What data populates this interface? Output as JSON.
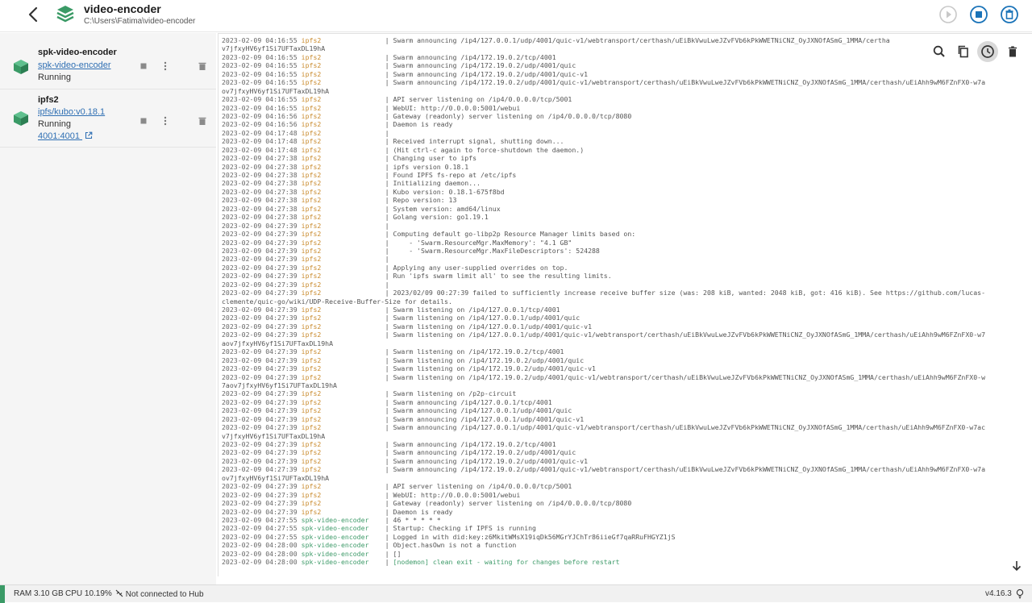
{
  "header": {
    "title": "video-encoder",
    "path": "C:\\Users\\Fatima\\video-encoder"
  },
  "containers": [
    {
      "name": "spk-video-encoder",
      "image": "spk-video-encoder",
      "status": "Running",
      "port": ""
    },
    {
      "name": "ipfs2",
      "image": "ipfs/kubo:v0.18.1",
      "status": "Running",
      "port": "4001:4001"
    }
  ],
  "logs": [
    {
      "ts": "2023-02-09 04:16:55",
      "svc": "ipfs2",
      "msg": "Swarm announcing /ip4/127.0.0.1/udp/4001/quic-v1/webtransport/certhash/uEiBkVwuLweJZvFVb6kPkWWETNiCNZ_OyJXNOfASmG_1MMA/certha"
    },
    {
      "cont": "v7jfxyHV6yf1Si7UFTaxDL19hA"
    },
    {
      "ts": "2023-02-09 04:16:55",
      "svc": "ipfs2",
      "msg": "Swarm announcing /ip4/172.19.0.2/tcp/4001"
    },
    {
      "ts": "2023-02-09 04:16:55",
      "svc": "ipfs2",
      "msg": "Swarm announcing /ip4/172.19.0.2/udp/4001/quic"
    },
    {
      "ts": "2023-02-09 04:16:55",
      "svc": "ipfs2",
      "msg": "Swarm announcing /ip4/172.19.0.2/udp/4001/quic-v1"
    },
    {
      "ts": "2023-02-09 04:16:55",
      "svc": "ipfs2",
      "msg": "Swarm announcing /ip4/172.19.0.2/udp/4001/quic-v1/webtransport/certhash/uEiBkVwuLweJZvFVb6kPkWWETNiCNZ_OyJXNOfASmG_1MMA/certhash/uEiAhh9wM6FZnFX0-w7a"
    },
    {
      "cont": "ov7jfxyHV6yf1Si7UFTaxDL19hA"
    },
    {
      "ts": "2023-02-09 04:16:55",
      "svc": "ipfs2",
      "msg": "API server listening on /ip4/0.0.0.0/tcp/5001"
    },
    {
      "ts": "2023-02-09 04:16:55",
      "svc": "ipfs2",
      "msg": "WebUI: http://0.0.0.0:5001/webui"
    },
    {
      "ts": "2023-02-09 04:16:56",
      "svc": "ipfs2",
      "msg": "Gateway (readonly) server listening on /ip4/0.0.0.0/tcp/8080"
    },
    {
      "ts": "2023-02-09 04:16:56",
      "svc": "ipfs2",
      "msg": "Daemon is ready"
    },
    {
      "ts": "2023-02-09 04:17:48",
      "svc": "ipfs2",
      "msg": ""
    },
    {
      "ts": "2023-02-09 04:17:48",
      "svc": "ipfs2",
      "msg": "Received interrupt signal, shutting down..."
    },
    {
      "ts": "2023-02-09 04:17:48",
      "svc": "ipfs2",
      "msg": "(Hit ctrl-c again to force-shutdown the daemon.)"
    },
    {
      "ts": "2023-02-09 04:27:38",
      "svc": "ipfs2",
      "msg": "Changing user to ipfs"
    },
    {
      "ts": "2023-02-09 04:27:38",
      "svc": "ipfs2",
      "msg": "ipfs version 0.18.1"
    },
    {
      "ts": "2023-02-09 04:27:38",
      "svc": "ipfs2",
      "msg": "Found IPFS fs-repo at /etc/ipfs"
    },
    {
      "ts": "2023-02-09 04:27:38",
      "svc": "ipfs2",
      "msg": "Initializing daemon..."
    },
    {
      "ts": "2023-02-09 04:27:38",
      "svc": "ipfs2",
      "msg": "Kubo version: 0.18.1-675f8bd"
    },
    {
      "ts": "2023-02-09 04:27:38",
      "svc": "ipfs2",
      "msg": "Repo version: 13"
    },
    {
      "ts": "2023-02-09 04:27:38",
      "svc": "ipfs2",
      "msg": "System version: amd64/linux"
    },
    {
      "ts": "2023-02-09 04:27:38",
      "svc": "ipfs2",
      "msg": "Golang version: go1.19.1"
    },
    {
      "ts": "2023-02-09 04:27:39",
      "svc": "ipfs2",
      "msg": ""
    },
    {
      "ts": "2023-02-09 04:27:39",
      "svc": "ipfs2",
      "msg": "Computing default go-libp2p Resource Manager limits based on:"
    },
    {
      "ts": "2023-02-09 04:27:39",
      "svc": "ipfs2",
      "msg": "    - 'Swarm.ResourceMgr.MaxMemory': \"4.1 GB\""
    },
    {
      "ts": "2023-02-09 04:27:39",
      "svc": "ipfs2",
      "msg": "    - 'Swarm.ResourceMgr.MaxFileDescriptors': 524288"
    },
    {
      "ts": "2023-02-09 04:27:39",
      "svc": "ipfs2",
      "msg": ""
    },
    {
      "ts": "2023-02-09 04:27:39",
      "svc": "ipfs2",
      "msg": "Applying any user-supplied overrides on top."
    },
    {
      "ts": "2023-02-09 04:27:39",
      "svc": "ipfs2",
      "msg": "Run 'ipfs swarm limit all' to see the resulting limits."
    },
    {
      "ts": "2023-02-09 04:27:39",
      "svc": "ipfs2",
      "msg": ""
    },
    {
      "ts": "2023-02-09 04:27:39",
      "svc": "ipfs2",
      "msg": "2023/02/09 00:27:39 failed to sufficiently increase receive buffer size (was: 208 kiB, wanted: 2048 kiB, got: 416 kiB). See https://github.com/lucas-"
    },
    {
      "cont": "clemente/quic-go/wiki/UDP-Receive-Buffer-Size for details."
    },
    {
      "ts": "2023-02-09 04:27:39",
      "svc": "ipfs2",
      "msg": "Swarm listening on /ip4/127.0.0.1/tcp/4001"
    },
    {
      "ts": "2023-02-09 04:27:39",
      "svc": "ipfs2",
      "msg": "Swarm listening on /ip4/127.0.0.1/udp/4001/quic"
    },
    {
      "ts": "2023-02-09 04:27:39",
      "svc": "ipfs2",
      "msg": "Swarm listening on /ip4/127.0.0.1/udp/4001/quic-v1"
    },
    {
      "ts": "2023-02-09 04:27:39",
      "svc": "ipfs2",
      "msg": "Swarm listening on /ip4/127.0.0.1/udp/4001/quic-v1/webtransport/certhash/uEiBkVwuLweJZvFVb6kPkWWETNiCNZ_OyJXNOfASmG_1MMA/certhash/uEiAhh9wM6FZnFX0-w7"
    },
    {
      "cont": "aov7jfxyHV6yf1Si7UFTaxDL19hA"
    },
    {
      "ts": "2023-02-09 04:27:39",
      "svc": "ipfs2",
      "msg": "Swarm listening on /ip4/172.19.0.2/tcp/4001"
    },
    {
      "ts": "2023-02-09 04:27:39",
      "svc": "ipfs2",
      "msg": "Swarm listening on /ip4/172.19.0.2/udp/4001/quic"
    },
    {
      "ts": "2023-02-09 04:27:39",
      "svc": "ipfs2",
      "msg": "Swarm listening on /ip4/172.19.0.2/udp/4001/quic-v1"
    },
    {
      "ts": "2023-02-09 04:27:39",
      "svc": "ipfs2",
      "msg": "Swarm listening on /ip4/172.19.0.2/udp/4001/quic-v1/webtransport/certhash/uEiBkVwuLweJZvFVb6kPkWWETNiCNZ_OyJXNOfASmG_1MMA/certhash/uEiAhh9wM6FZnFX0-w"
    },
    {
      "cont": "7aov7jfxyHV6yf1Si7UFTaxDL19hA"
    },
    {
      "ts": "2023-02-09 04:27:39",
      "svc": "ipfs2",
      "msg": "Swarm listening on /p2p-circuit"
    },
    {
      "ts": "2023-02-09 04:27:39",
      "svc": "ipfs2",
      "msg": "Swarm announcing /ip4/127.0.0.1/tcp/4001"
    },
    {
      "ts": "2023-02-09 04:27:39",
      "svc": "ipfs2",
      "msg": "Swarm announcing /ip4/127.0.0.1/udp/4001/quic"
    },
    {
      "ts": "2023-02-09 04:27:39",
      "svc": "ipfs2",
      "msg": "Swarm announcing /ip4/127.0.0.1/udp/4001/quic-v1"
    },
    {
      "ts": "2023-02-09 04:27:39",
      "svc": "ipfs2",
      "msg": "Swarm announcing /ip4/127.0.0.1/udp/4001/quic-v1/webtransport/certhash/uEiBkVwuLweJZvFVb6kPkWWETNiCNZ_OyJXNOfASmG_1MMA/certhash/uEiAhh9wM6FZnFX0-w7ac"
    },
    {
      "cont": "v7jfxyHV6yf1Si7UFTaxDL19hA"
    },
    {
      "ts": "2023-02-09 04:27:39",
      "svc": "ipfs2",
      "msg": "Swarm announcing /ip4/172.19.0.2/tcp/4001"
    },
    {
      "ts": "2023-02-09 04:27:39",
      "svc": "ipfs2",
      "msg": "Swarm announcing /ip4/172.19.0.2/udp/4001/quic"
    },
    {
      "ts": "2023-02-09 04:27:39",
      "svc": "ipfs2",
      "msg": "Swarm announcing /ip4/172.19.0.2/udp/4001/quic-v1"
    },
    {
      "ts": "2023-02-09 04:27:39",
      "svc": "ipfs2",
      "msg": "Swarm announcing /ip4/172.19.0.2/udp/4001/quic-v1/webtransport/certhash/uEiBkVwuLweJZvFVb6kPkWWETNiCNZ_OyJXNOfASmG_1MMA/certhash/uEiAhh9wM6FZnFX0-w7a"
    },
    {
      "cont": "ov7jfxyHV6yf1Si7UFTaxDL19hA"
    },
    {
      "ts": "2023-02-09 04:27:39",
      "svc": "ipfs2",
      "msg": "API server listening on /ip4/0.0.0.0/tcp/5001"
    },
    {
      "ts": "2023-02-09 04:27:39",
      "svc": "ipfs2",
      "msg": "WebUI: http://0.0.0.0:5001/webui"
    },
    {
      "ts": "2023-02-09 04:27:39",
      "svc": "ipfs2",
      "msg": "Gateway (readonly) server listening on /ip4/0.0.0.0/tcp/8080"
    },
    {
      "ts": "2023-02-09 04:27:39",
      "svc": "ipfs2",
      "msg": "Daemon is ready"
    },
    {
      "ts": "2023-02-09 04:27:55",
      "svc": "spk-video-encoder",
      "msg": "46 * * * * *"
    },
    {
      "ts": "2023-02-09 04:27:55",
      "svc": "spk-video-encoder",
      "msg": "Startup: Checking if IPFS is running"
    },
    {
      "ts": "2023-02-09 04:27:55",
      "svc": "spk-video-encoder",
      "msg": "Logged in with did:key:z6MkitWMsX19iqDk56MGrYJChTr86iieGf7qaRRuFHGYZ1jS"
    },
    {
      "ts": "2023-02-09 04:28:00",
      "svc": "spk-video-encoder",
      "msg": "Object.hasOwn is not a function"
    },
    {
      "ts": "2023-02-09 04:28:00",
      "svc": "spk-video-encoder",
      "msg": "[]"
    },
    {
      "ts": "2023-02-09 04:28:00",
      "svc": "spk-video-encoder",
      "msg": "[nodemon] clean exit - waiting for changes before restart",
      "green": true
    }
  ],
  "statusbar": {
    "ram": "RAM 3.10 GB",
    "cpu": "CPU 10.19%",
    "hub": "Not connected to Hub",
    "version": "v4.16.3"
  },
  "icons": {
    "back": "back-arrow-icon",
    "app": "stack-layers-icon",
    "search": "search-icon",
    "copy": "copy-icon",
    "timestamps": "clock-icon",
    "clear": "trash-icon"
  },
  "colors": {
    "accent": "#1a73b8",
    "container_icon": "#3a9a66",
    "ipfs_service": "#c98a2c",
    "spk_service": "#3f9b6a"
  }
}
